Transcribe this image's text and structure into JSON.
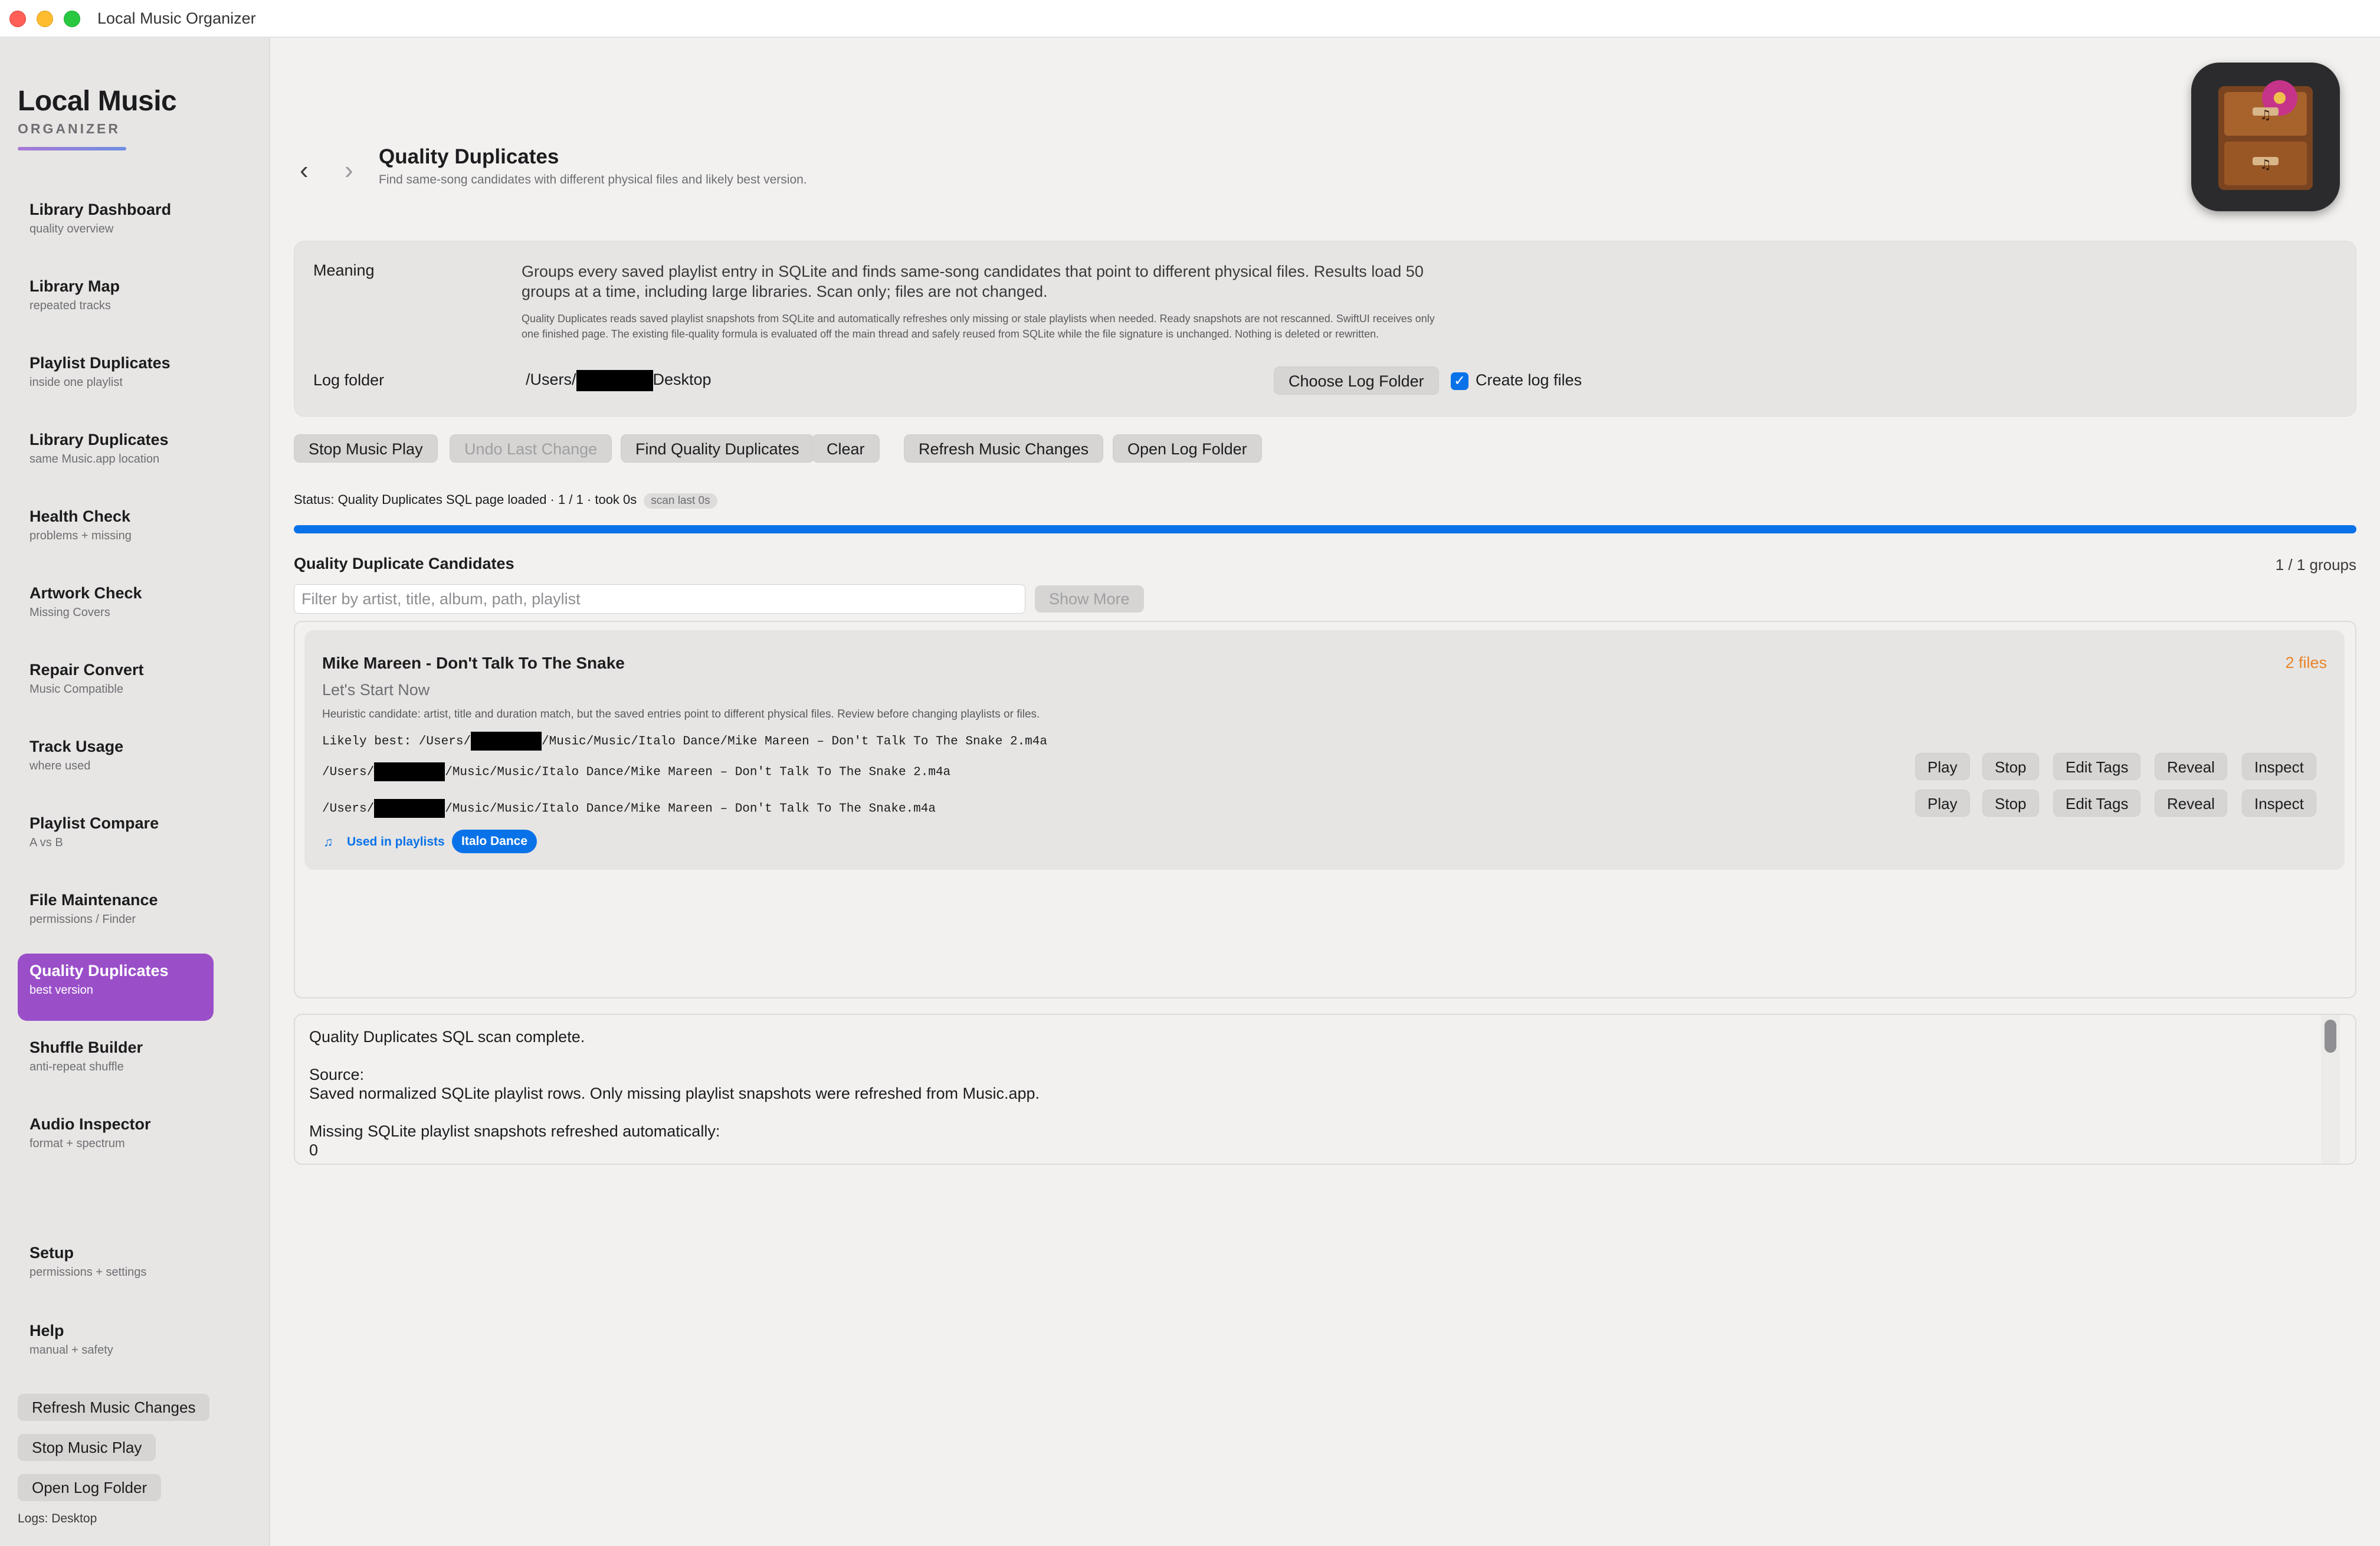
{
  "window": {
    "title": "Local Music Organizer"
  },
  "brand": {
    "title": "Local Music",
    "subtitle": "ORGANIZER"
  },
  "sidebar": {
    "items": [
      {
        "label": "Library Dashboard",
        "sub": "quality overview"
      },
      {
        "label": "Library Map",
        "sub": "repeated tracks"
      },
      {
        "label": "Playlist Duplicates",
        "sub": "inside one playlist"
      },
      {
        "label": "Library Duplicates",
        "sub": "same Music.app location"
      },
      {
        "label": "Health Check",
        "sub": "problems + missing"
      },
      {
        "label": "Artwork Check",
        "sub": "Missing Covers"
      },
      {
        "label": "Repair Convert",
        "sub": "Music Compatible"
      },
      {
        "label": "Track Usage",
        "sub": "where used"
      },
      {
        "label": "Playlist Compare",
        "sub": "A vs B"
      },
      {
        "label": "File Maintenance",
        "sub": "permissions / Finder"
      },
      {
        "label": "Quality Duplicates",
        "sub": "best version"
      },
      {
        "label": "Shuffle Builder",
        "sub": "anti-repeat shuffle"
      },
      {
        "label": "Audio Inspector",
        "sub": "format + spectrum"
      },
      {
        "label": "Setup",
        "sub": "permissions + settings"
      },
      {
        "label": "Help",
        "sub": "manual + safety"
      }
    ],
    "buttons": {
      "refresh": "Refresh Music Changes",
      "stop": "Stop Music Play",
      "open_log": "Open Log Folder"
    },
    "footer": "Logs: Desktop"
  },
  "header": {
    "title": "Quality Duplicates",
    "subtitle": "Find same-song candidates with different physical files and likely best version."
  },
  "meaning": {
    "label": "Meaning",
    "text": "Groups every saved playlist entry in SQLite and finds same-song candidates that point to different physical files. Results load 50 groups at a time, including large libraries. Scan only; files are not changed.",
    "detail": "Quality Duplicates reads saved playlist snapshots from SQLite and automatically refreshes only missing or stale playlists when needed. Ready snapshots are not rescanned. SwiftUI receives only one finished page. The existing file-quality formula is evaluated off the main thread and safely reused from SQLite while the file signature is unchanged. Nothing is deleted or rewritten.",
    "log_label": "Log folder",
    "log_path_prefix": "/Users/",
    "log_path_suffix": "Desktop",
    "choose_button": "Choose Log Folder",
    "create_logs_label": "Create log files",
    "create_logs_checked": true
  },
  "toolbar": {
    "stop": "Stop Music Play",
    "undo": "Undo Last Change",
    "find": "Find Quality Duplicates",
    "clear": "Clear",
    "refresh": "Refresh Music Changes",
    "open_log": "Open Log Folder"
  },
  "status": {
    "text": "Status: Quality Duplicates SQL page loaded · 1 / 1 · took 0s",
    "badge": "scan last 0s",
    "progress": 1.0
  },
  "candidates": {
    "title": "Quality Duplicate Candidates",
    "count": "1 / 1 groups",
    "filter_placeholder": "Filter by artist, title, album, path, playlist",
    "show_more": "Show More",
    "group": {
      "title": "Mike Mareen - Don't Talk To The Snake",
      "files": "2 files",
      "album": "Let's Start Now",
      "heuristic": "Heuristic candidate: artist, title and duration match, but the saved entries point to different physical files. Review before changing playlists or files.",
      "likely_prefix": "Likely best: /Users/",
      "likely_suffix": "/Music/Music/Italo Dance/Mike Mareen – Don't Talk To The Snake 2.m4a",
      "files_list": [
        {
          "prefix": "/Users/",
          "suffix": "/Music/Music/Italo Dance/Mike Mareen – Don't Talk To The Snake 2.m4a"
        },
        {
          "prefix": "/Users/",
          "suffix": "/Music/Music/Italo Dance/Mike Mareen – Don't Talk To The Snake.m4a"
        }
      ],
      "actions": {
        "play": "Play",
        "stop": "Stop",
        "edit": "Edit Tags",
        "reveal": "Reveal",
        "inspect": "Inspect"
      },
      "used_label": "Used in playlists",
      "playlist": "Italo Dance"
    }
  },
  "log": {
    "lines": [
      "Quality Duplicates SQL scan complete.",
      "",
      "Source:",
      "Saved normalized SQLite playlist rows. Only missing playlist snapshots were refreshed from Music.app.",
      "",
      "Missing SQLite playlist snapshots refreshed automatically:",
      "0"
    ]
  },
  "colors": {
    "accent": "#0a72e8",
    "active_nav": "#9a4fc9",
    "files_count": "#e8842a"
  }
}
